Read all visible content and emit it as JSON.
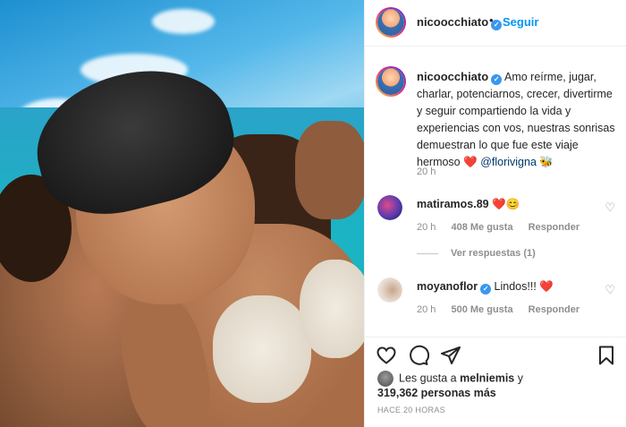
{
  "post": {
    "author": "nicoocchiato",
    "follow_label": "Seguir",
    "caption_pre": "Amo reírme, jugar, charlar, potenciarnos, crecer, divertirme y seguir compartiendo la vida y experiencias con vos, nuestras sonrisas demuestran lo que fue este viaje hermoso",
    "caption_heart": "❤️",
    "caption_mention": "@florivigna",
    "caption_bee": "🐝",
    "caption_time": "20 h"
  },
  "comments": [
    {
      "user": "matiramos.89",
      "text": "❤️😊",
      "time": "20 h",
      "likes": "408 Me gusta",
      "reply_label": "Responder",
      "replies_label": "Ver respuestas (1)"
    },
    {
      "user": "moyanoflor",
      "text": "Lindos!!! ❤️",
      "time": "20 h",
      "likes": "500 Me gusta",
      "reply_label": "Responder"
    }
  ],
  "likes": {
    "prefix": "Les gusta a",
    "first_user": "melniemis",
    "conjunction": "y",
    "others": "319,362 personas más"
  },
  "time_ago": "HACE 20 HORAS",
  "colors": {
    "accent": "#0095f6",
    "verified": "#3897f0",
    "heart": "#e0245e",
    "muted": "#8e8e8e"
  },
  "icons": [
    "heart-icon",
    "comment-icon",
    "share-icon",
    "bookmark-icon",
    "verified-icon"
  ]
}
